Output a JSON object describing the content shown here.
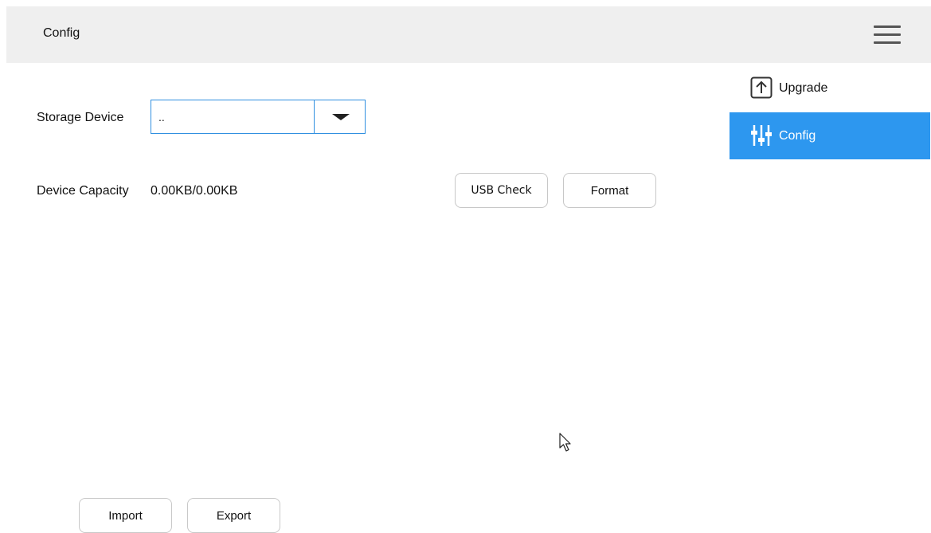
{
  "header": {
    "title": "Config"
  },
  "storage": {
    "label": "Storage Device",
    "selected_value": ".."
  },
  "capacity": {
    "label": "Device Capacity",
    "value": "0.00KB/0.00KB"
  },
  "buttons": {
    "usb_check": "USB Check",
    "format": "Format",
    "import": "Import",
    "export": "Export"
  },
  "sidebar": {
    "items": [
      {
        "label": "Upgrade",
        "icon": "upload-arrow-icon",
        "active": false
      },
      {
        "label": "Config",
        "icon": "sliders-icon",
        "active": true
      }
    ]
  },
  "colors": {
    "accent": "#2d97ef",
    "header_bg": "#efefef",
    "select_border": "#2f8fe0"
  }
}
